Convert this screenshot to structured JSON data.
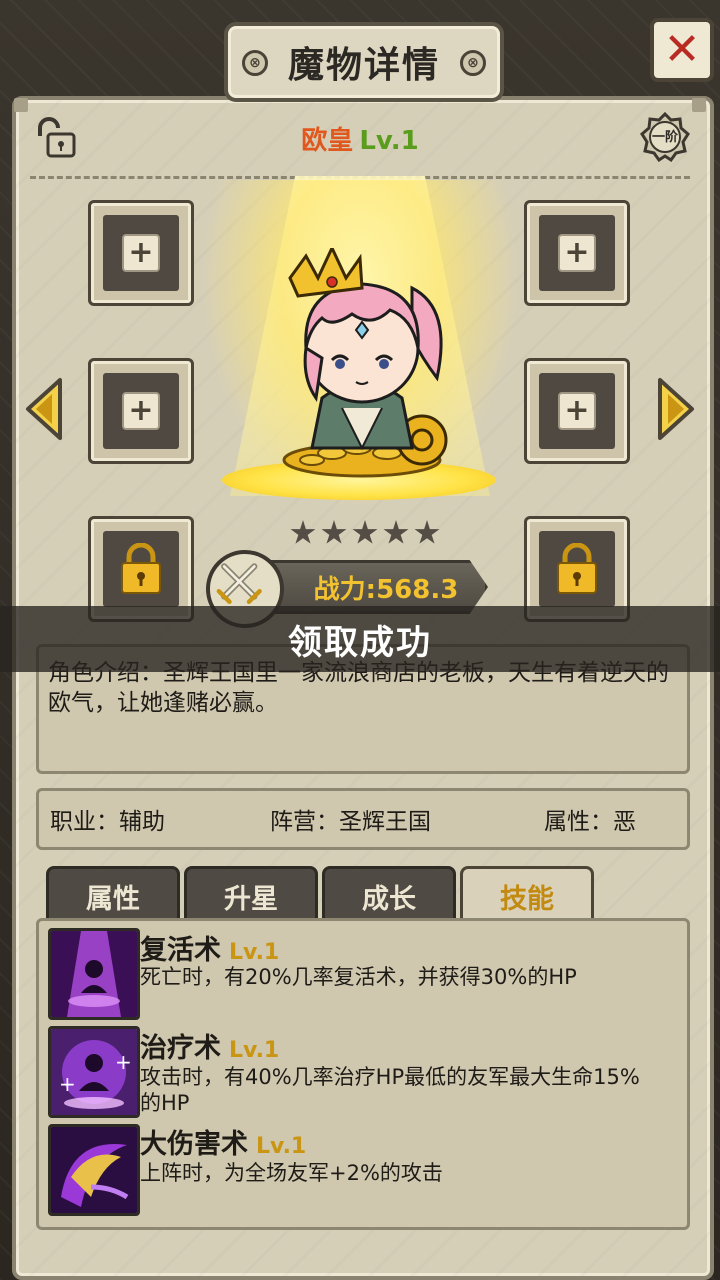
{
  "header": {
    "title": "魔物详情",
    "close_label": "✕",
    "rivet_left": "⊗",
    "rivet_right": "⊗"
  },
  "monster": {
    "name": "欧皇",
    "level": "Lv.1",
    "rank": "一阶",
    "stars": 5,
    "power_label": "战力:568.3"
  },
  "equipment_slots": {
    "add_symbol": "+"
  },
  "toast": {
    "message": "领取成功"
  },
  "description": {
    "text": "角色介绍：圣辉王国里一家流浪商店的老板，天生有着逆天的欧气，让她逢赌必赢。"
  },
  "info": {
    "job": "职业：辅助",
    "faction": "阵营：圣辉王国",
    "attribute": "属性：恶"
  },
  "tabs": [
    {
      "label": "属性",
      "active": false
    },
    {
      "label": "升星",
      "active": false
    },
    {
      "label": "成长",
      "active": false
    },
    {
      "label": "技能",
      "active": true
    }
  ],
  "skills": [
    {
      "name": "复活术",
      "level": "Lv.1",
      "desc": "死亡时，有20%几率复活术，并获得30%的HP"
    },
    {
      "name": "治疗术",
      "level": "Lv.1",
      "desc": "攻击时，有40%几率治疗HP最低的友军最大生命15%的HP"
    },
    {
      "name": "大伤害术",
      "level": "Lv.1",
      "desc": "上阵时，为全场友军+2%的攻击"
    }
  ],
  "colors": {
    "accent_gold": "#c38a12",
    "name_orange": "#e0581e",
    "level_green": "#5a9d1e",
    "close_red": "#b82a22"
  }
}
